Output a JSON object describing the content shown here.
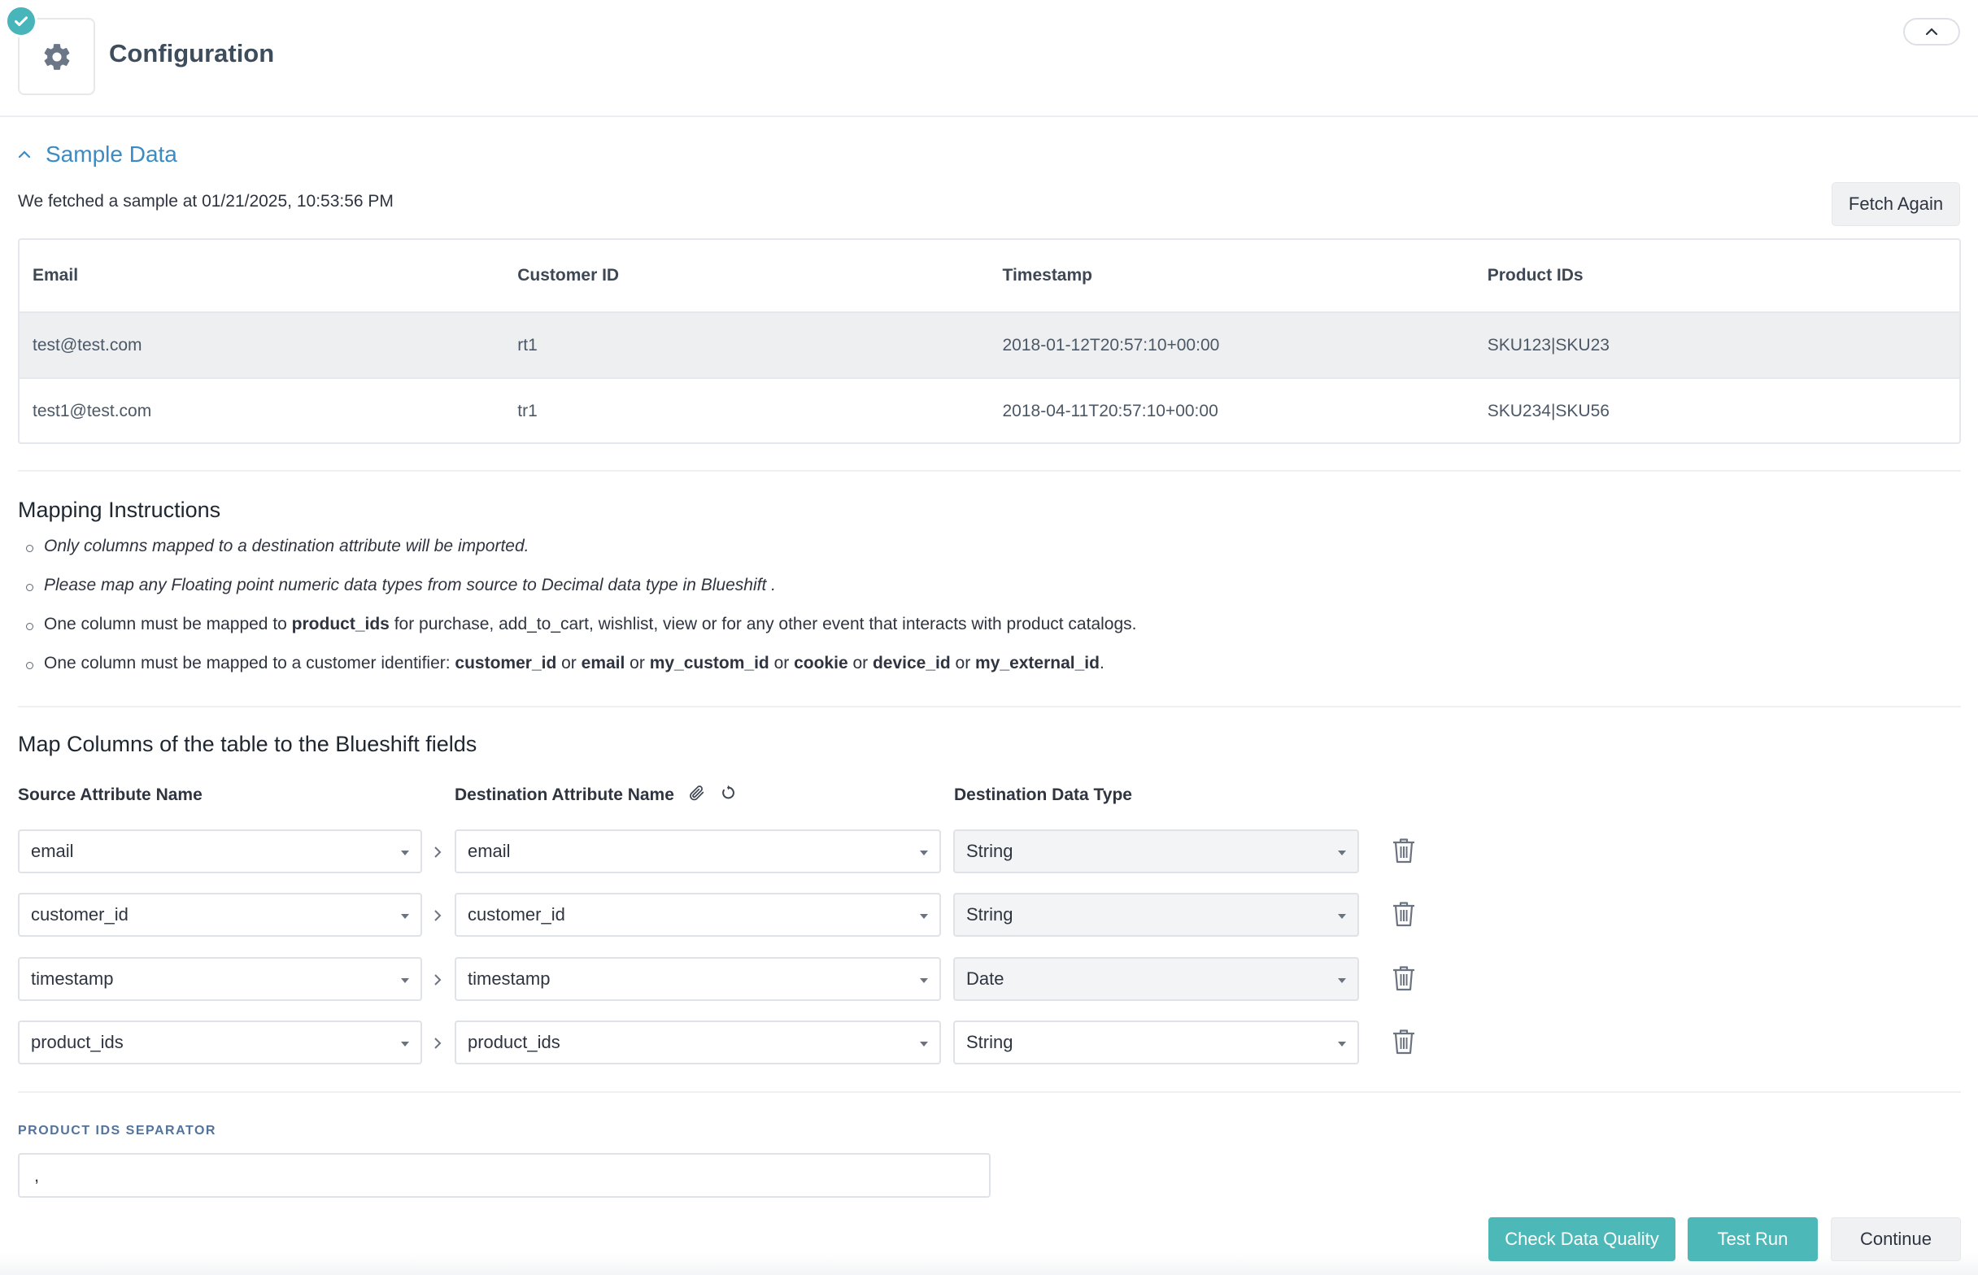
{
  "header": {
    "title": "Configuration",
    "icon": "gear-icon",
    "status_icon": "check-icon"
  },
  "sample": {
    "section_title": "Sample Data",
    "fetched_text": "We fetched a sample at 01/21/2025, 10:53:56 PM",
    "fetch_again_label": "Fetch Again",
    "table": {
      "headers": [
        "Email",
        "Customer ID",
        "Timestamp",
        "Product IDs"
      ],
      "rows": [
        [
          "test@test.com",
          "rt1",
          "2018-01-12T20:57:10+00:00",
          "SKU123|SKU23"
        ],
        [
          "test1@test.com",
          "tr1",
          "2018-04-11T20:57:10+00:00",
          "SKU234|SKU56"
        ]
      ]
    }
  },
  "instructions": {
    "title": "Mapping Instructions",
    "items": {
      "i1": "Only columns mapped to a destination attribute will be imported.",
      "i2": "Please map any Floating point numeric data types from source to Decimal data type in Blueshift .",
      "i3": {
        "a": "One column must be mapped to ",
        "b": "product_ids",
        "c": " for purchase, add_to_cart, wishlist, view or for any other event that interacts with product catalogs."
      },
      "i4": {
        "a": "One column must be mapped to a customer identifier: ",
        "k1": "customer_id",
        "or1": " or ",
        "k2": "email",
        "or2": " or ",
        "k3": "my_custom_id",
        "or3": " or ",
        "k4": "cookie",
        "or4": " or ",
        "k5": "device_id",
        "or5": " or ",
        "k6": "my_external_id",
        "end": "."
      }
    }
  },
  "mapping": {
    "title": "Map Columns of the table to the Blueshift fields",
    "source_header": "Source Attribute Name",
    "dest_header": "Destination Attribute Name",
    "type_header": "Destination Data Type",
    "rows": [
      {
        "source": "email",
        "dest": "email",
        "type": "String"
      },
      {
        "source": "customer_id",
        "dest": "customer_id",
        "type": "String"
      },
      {
        "source": "timestamp",
        "dest": "timestamp",
        "type": "Date"
      },
      {
        "source": "product_ids",
        "dest": "product_ids",
        "type": "String"
      }
    ]
  },
  "separator": {
    "label": "PRODUCT IDS SEPARATOR",
    "value": ","
  },
  "footer": {
    "check_quality_label": "Check Data Quality",
    "test_run_label": "Test Run",
    "continue_label": "Continue"
  },
  "colors": {
    "accent": "#47b5b9",
    "link": "#3b8bc4",
    "label": "#52739b"
  }
}
